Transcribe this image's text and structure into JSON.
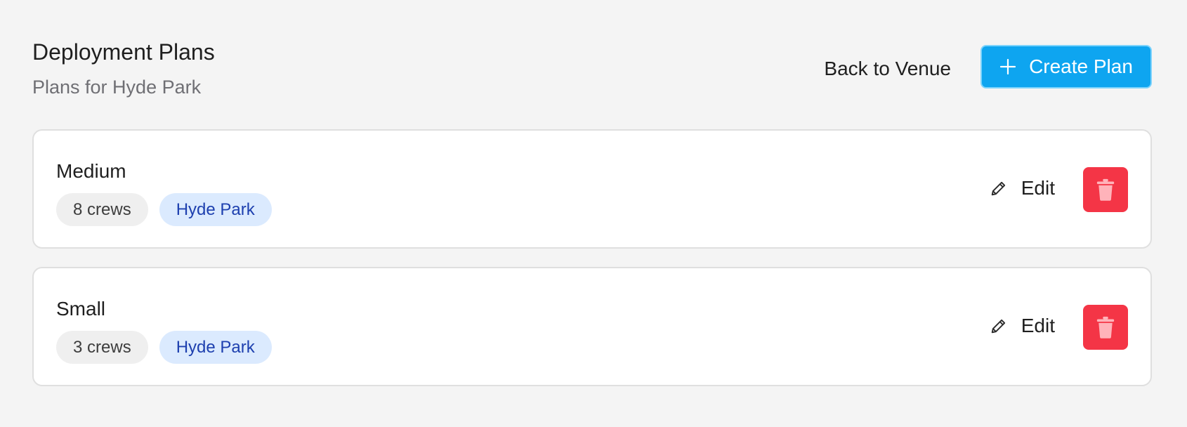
{
  "header": {
    "title": "Deployment Plans",
    "subtitle": "Plans for Hyde Park",
    "back_label": "Back to Venue",
    "create_label": "Create Plan"
  },
  "plans": [
    {
      "name": "Medium",
      "crews": "8 crews",
      "venue": "Hyde Park",
      "edit_label": "Edit"
    },
    {
      "name": "Small",
      "crews": "3 crews",
      "venue": "Hyde Park",
      "edit_label": "Edit"
    }
  ],
  "colors": {
    "background": "#f4f4f4",
    "primary": "#0ea5f0",
    "danger": "#f43546",
    "venue_tag_bg": "#dbeafe",
    "venue_tag_text": "#1e40af"
  },
  "icons": {
    "create": "plus-icon",
    "edit": "pencil-icon",
    "delete": "trash-icon"
  }
}
